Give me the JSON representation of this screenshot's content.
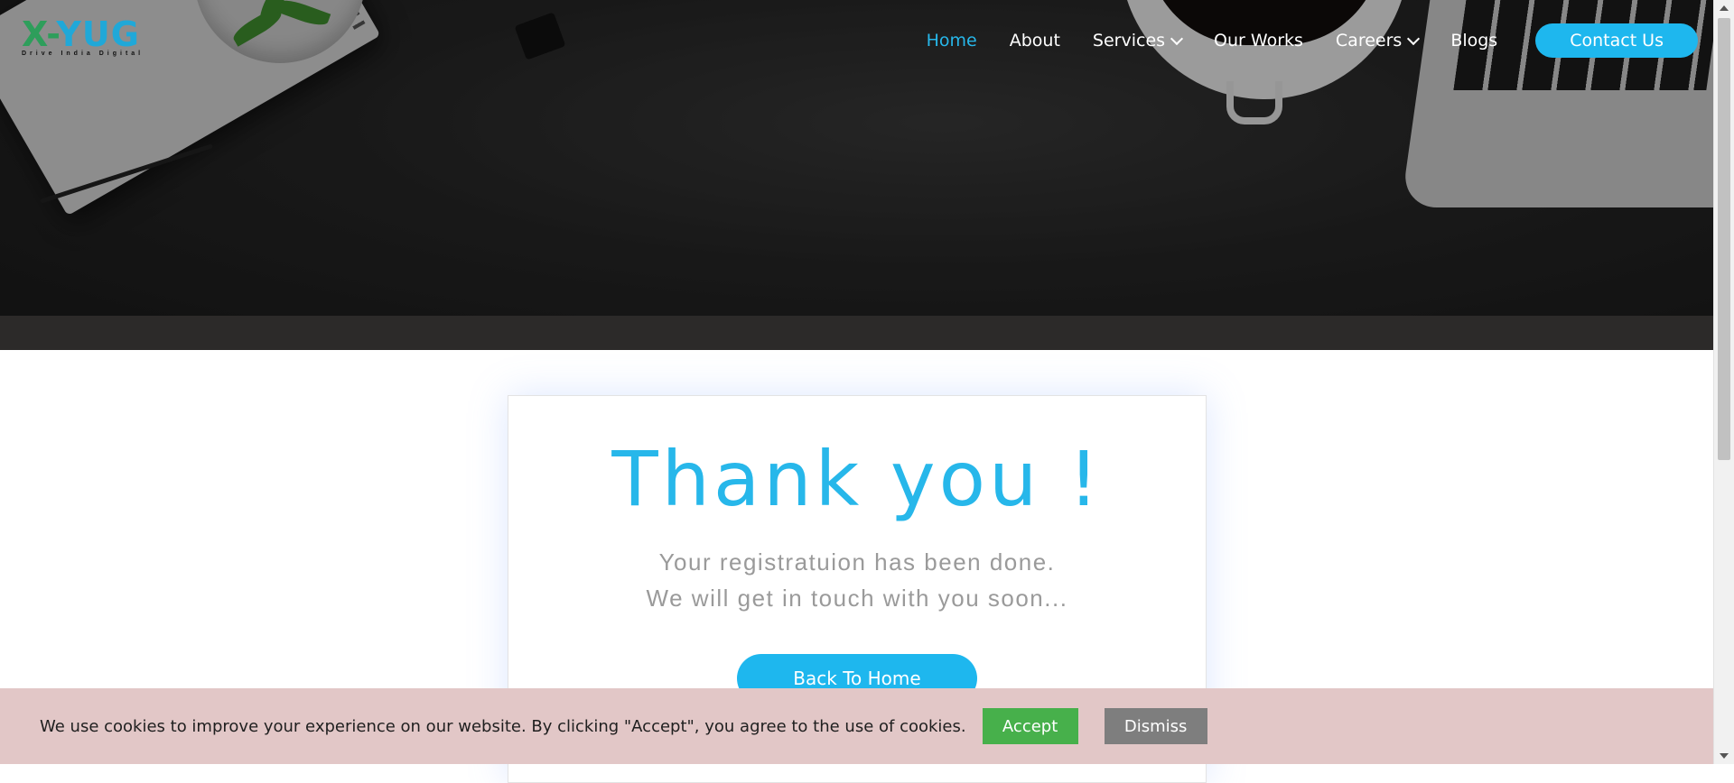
{
  "brand": {
    "logo_text": "X-YUG",
    "tagline": "Drive India Digital"
  },
  "nav": {
    "items": [
      {
        "label": "Home",
        "active": true,
        "dropdown": false
      },
      {
        "label": "About",
        "active": false,
        "dropdown": false
      },
      {
        "label": "Services",
        "active": false,
        "dropdown": true
      },
      {
        "label": "Our Works",
        "active": false,
        "dropdown": false
      },
      {
        "label": "Careers",
        "active": false,
        "dropdown": true
      },
      {
        "label": "Blogs",
        "active": false,
        "dropdown": false
      }
    ],
    "contact_label": "Contact Us"
  },
  "card": {
    "heading": "Thank you !",
    "line1": "Your registratuion has been done.",
    "line2": "We will get in touch with you soon...",
    "button_label": "Back To Home"
  },
  "cookie": {
    "text": "We use cookies to improve your experience on our website. By clicking \"Accept\", you agree to the use of cookies.",
    "accept_label": "Accept",
    "dismiss_label": "Dismiss"
  },
  "colors": {
    "accent": "#1eb7ee",
    "accept": "#47b04b",
    "dismiss": "#7e7e7e",
    "cookie_bg": "#e2c7c7"
  }
}
